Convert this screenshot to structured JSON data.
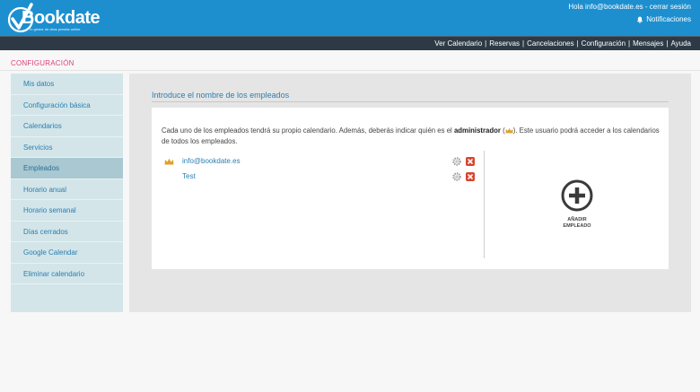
{
  "header": {
    "logo_text": "Bookdate",
    "logo_tagline": "Tu gestor de citas previas online",
    "greeting": "Hola info@bookdate.es - cerrar sesión",
    "notifications": "Notificaciones"
  },
  "nav": {
    "items": [
      "Ver Calendario",
      "Reservas",
      "Cancelaciones",
      "Configuración",
      "Mensajes",
      "Ayuda"
    ],
    "separator": "|"
  },
  "section": {
    "title": "CONFIGURACIÓN"
  },
  "sidebar": {
    "items": [
      {
        "label": "Mis datos"
      },
      {
        "label": "Configuración básica"
      },
      {
        "label": "Calendarios"
      },
      {
        "label": "Servicios"
      },
      {
        "label": "Empleados"
      },
      {
        "label": "Horario anual"
      },
      {
        "label": "Horario semanal"
      },
      {
        "label": "Días cerrados"
      },
      {
        "label": "Google Calendar"
      },
      {
        "label": "Eliminar calendario"
      }
    ],
    "active": "Empleados"
  },
  "main": {
    "heading": "Introduce el nombre de los empleados",
    "desc_part1": "Cada uno de los empleados tendrá su propio calendario. Además, deberás indicar quién es el ",
    "desc_bold": "administrador",
    "desc_part2": " (",
    "desc_part3": "). Este usuario podrá acceder a los calendarios de todos los empleados.",
    "employees": [
      {
        "name": "info@bookdate.es",
        "is_admin": true
      },
      {
        "name": "Test",
        "is_admin": false
      }
    ],
    "add_button_line1": "AÑADIR",
    "add_button_line2": "EMPLEADO"
  },
  "colors": {
    "header_blue": "#1d8fcf",
    "nav_dark": "#2d3a46",
    "section_pink": "#e0407c",
    "link_blue": "#2a7fb0",
    "delete_red": "#d9442c",
    "crown_gold": "#e0a12a"
  },
  "icons": {
    "logo": "checkmark-logo-icon",
    "notifications": "bell-icon",
    "admin": "crown-icon",
    "edit": "gear-icon",
    "delete": "close-icon",
    "add": "plus-circle-icon"
  }
}
